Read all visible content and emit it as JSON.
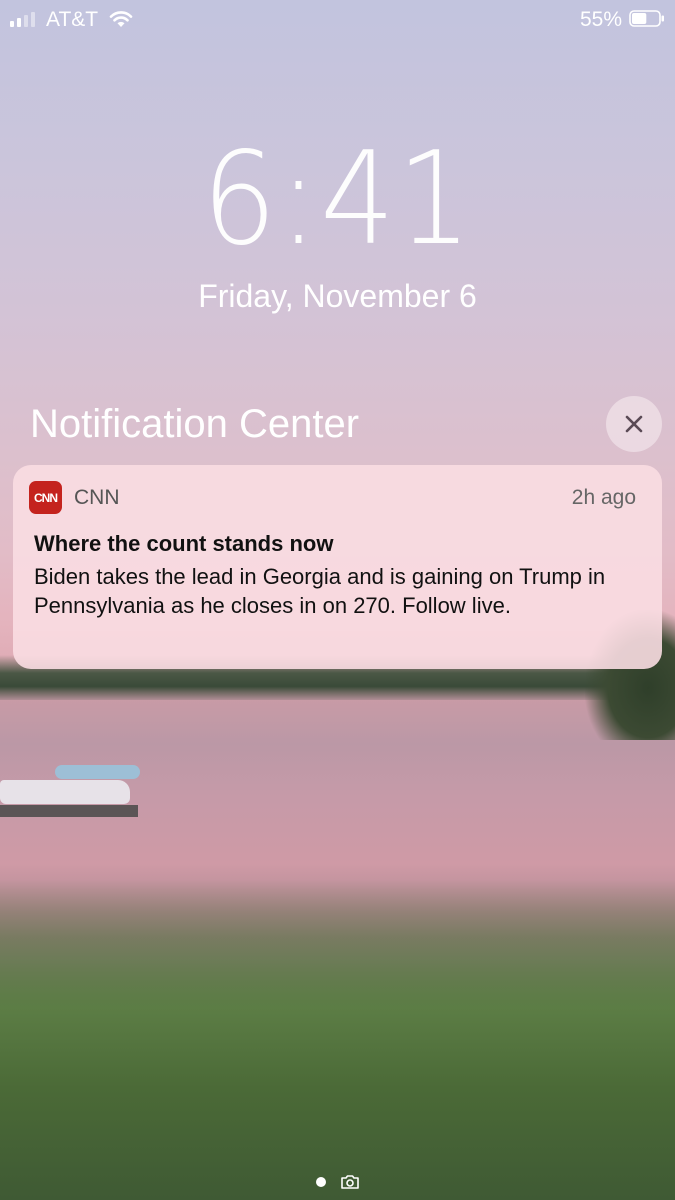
{
  "status_bar": {
    "carrier": "AT&T",
    "battery_percent": "55%",
    "battery_level": 0.55,
    "signal_bars": 2,
    "icons": [
      "signal-icon",
      "wifi-icon",
      "battery-icon"
    ]
  },
  "lock_screen": {
    "time": "6:41",
    "date": "Friday, November 6"
  },
  "notification_center": {
    "title": "Notification Center",
    "close_icon": "close-icon"
  },
  "notification": {
    "app_icon_text": "CNN",
    "app_name": "CNN",
    "time": "2h ago",
    "title": "Where the count stands now",
    "body": "Biden takes the lead in Georgia and is gaining on Trump in Pennsylvania as he closes in on 270. Follow live."
  },
  "footer": {
    "page_indicator_icon": "page-dot-icon",
    "camera_icon": "camera-icon"
  }
}
